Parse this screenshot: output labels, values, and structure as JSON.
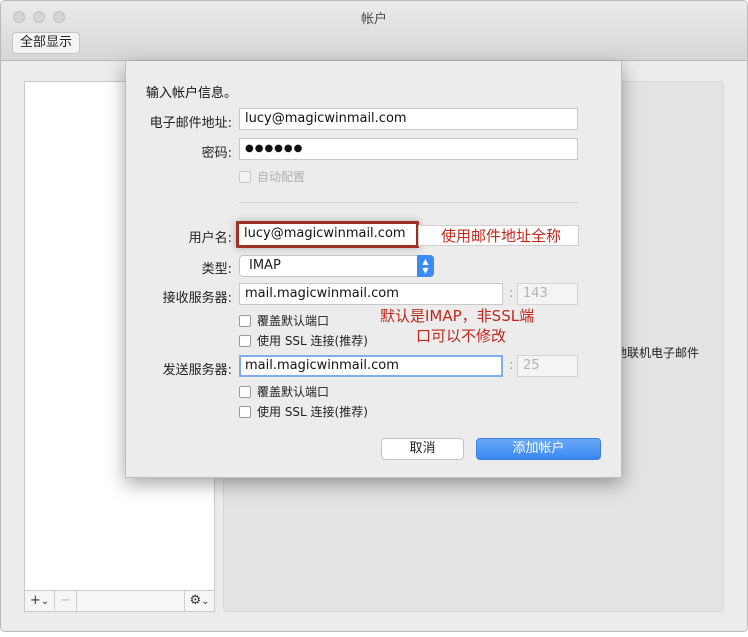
{
  "window": {
    "title": "帐户",
    "show_all": "全部显示"
  },
  "list_toolbar": {
    "add": "+",
    "add_menu": "⌄",
    "remove": "−",
    "gear": "⚙",
    "gear_menu": "⌄"
  },
  "background": {
    "partial_text": "地联机电子邮件"
  },
  "dialog": {
    "heading": "输入帐户信息。",
    "email_label": "电子邮件地址:",
    "email_value": "lucy@magicwinmail.com",
    "password_label": "密码:",
    "password_value": "●●●●●●",
    "auto_config_label": "自动配置",
    "username_label": "用户名:",
    "username_value": "lucy@magicwinmail.com",
    "type_label": "类型:",
    "type_value": "IMAP",
    "incoming_label": "接收服务器:",
    "incoming_value": "mail.magicwinmail.com",
    "incoming_port": "143",
    "outgoing_label": "发送服务器:",
    "outgoing_value": "mail.magicwinmail.com",
    "outgoing_port": "25",
    "port_colon": ":",
    "override_port_label": "覆盖默认端口",
    "use_ssl_label": "使用 SSL 连接(推荐)",
    "cancel_button": "取消",
    "add_button": "添加帐户"
  },
  "annotations": {
    "username_note": "使用邮件地址全称",
    "default_note_line1": "默认是IMAP，非SSL端",
    "default_note_line2": "口可以不修改"
  },
  "colors": {
    "annotation": "#c0281c",
    "primary_button": "#3b87f2",
    "highlight_border": "#b83a2a"
  }
}
